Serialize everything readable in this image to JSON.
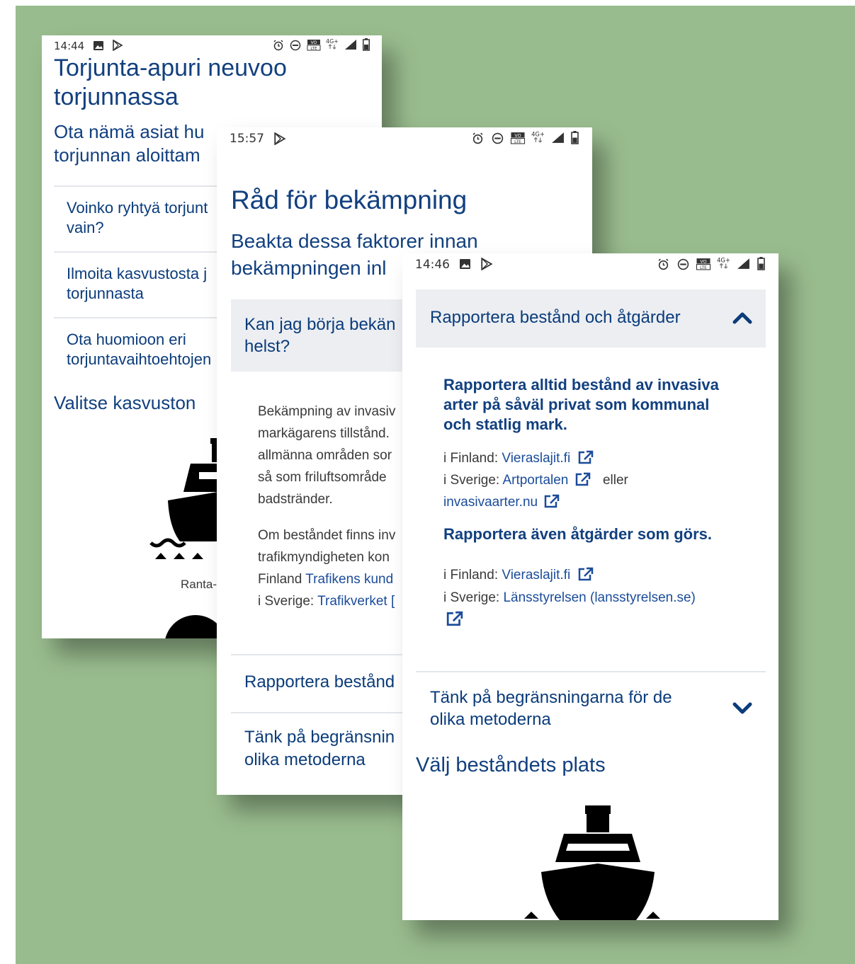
{
  "screen1": {
    "status_time": "14:44",
    "title_line1": "Torjunta-apuri neuvoo",
    "title_line2": "torjunnassa",
    "subtitle_line1": "Ota nämä asiat hu",
    "subtitle_line2": "torjunnan aloittam",
    "accordion": [
      {
        "line1": "Voinko ryhtyä torjunt",
        "line2": "vain?"
      },
      {
        "line1": "Ilmoita kasvustosta j",
        "line2": "torjunnasta"
      },
      {
        "line1": "Ota huomioon eri",
        "line2": "torjuntavaihtoehtojen"
      }
    ],
    "section_title": "Valitse kasvuston",
    "option_label": "Ranta-"
  },
  "screen2": {
    "status_time": "15:57",
    "title": "Råd för bekämpning",
    "subtitle_line1": "Beakta dessa faktorer innan",
    "subtitle_line2": "bekämpningen inl",
    "open_item_line1": "Kan jag börja bekän",
    "open_item_line2": "helst?",
    "para1": [
      "Bekämpning av invasiv",
      "markägarens tillstånd.",
      "allmänna områden sor",
      "så som friluftsområde",
      "badstränder."
    ],
    "para2_lines": [
      "Om beståndet finns inv",
      "trafikmyndigheten kon"
    ],
    "fin_prefix": "Finland ",
    "fin_link": "Trafikens kund",
    "swe_prefix": "i Sverige: ",
    "swe_link": "Trafikverket",
    "item2": "Rapportera bestånd",
    "item3_line1": "Tänk på begränsnin",
    "item3_line2": "olika metoderna"
  },
  "screen3": {
    "status_time": "14:46",
    "header": "Rapportera bestånd och åtgärder",
    "heading1_line1": "Rapportera alltid bestånd av invasiva",
    "heading1_line2": "arter på såväl privat som kommunal",
    "heading1_line3": "och statlig mark.",
    "fi1_prefix": "i Finland: ",
    "fi1_link": "Vieraslajit.fi",
    "se1_prefix": "i Sverige: ",
    "se1_link": "Artportalen",
    "se1_or": "eller",
    "se1_link2": "invasivaarter.nu",
    "heading2": "Rapportera även åtgärder som görs.",
    "fi2_prefix": "i Finland: ",
    "fi2_link": "Vieraslajit.fi",
    "se2_prefix": "i Sverige: ",
    "se2_link": "Länsstyrelsen (lansstyrelsen.se)",
    "item2_line1": "Tänk på begränsningarna för de",
    "item2_line2": "olika metoderna",
    "section_title": "Välj beståndets plats"
  },
  "colors": {
    "background": "#99bc8e",
    "heading": "#12407f",
    "link": "#1b4c9a",
    "accordion_bg": "#eceef2"
  }
}
